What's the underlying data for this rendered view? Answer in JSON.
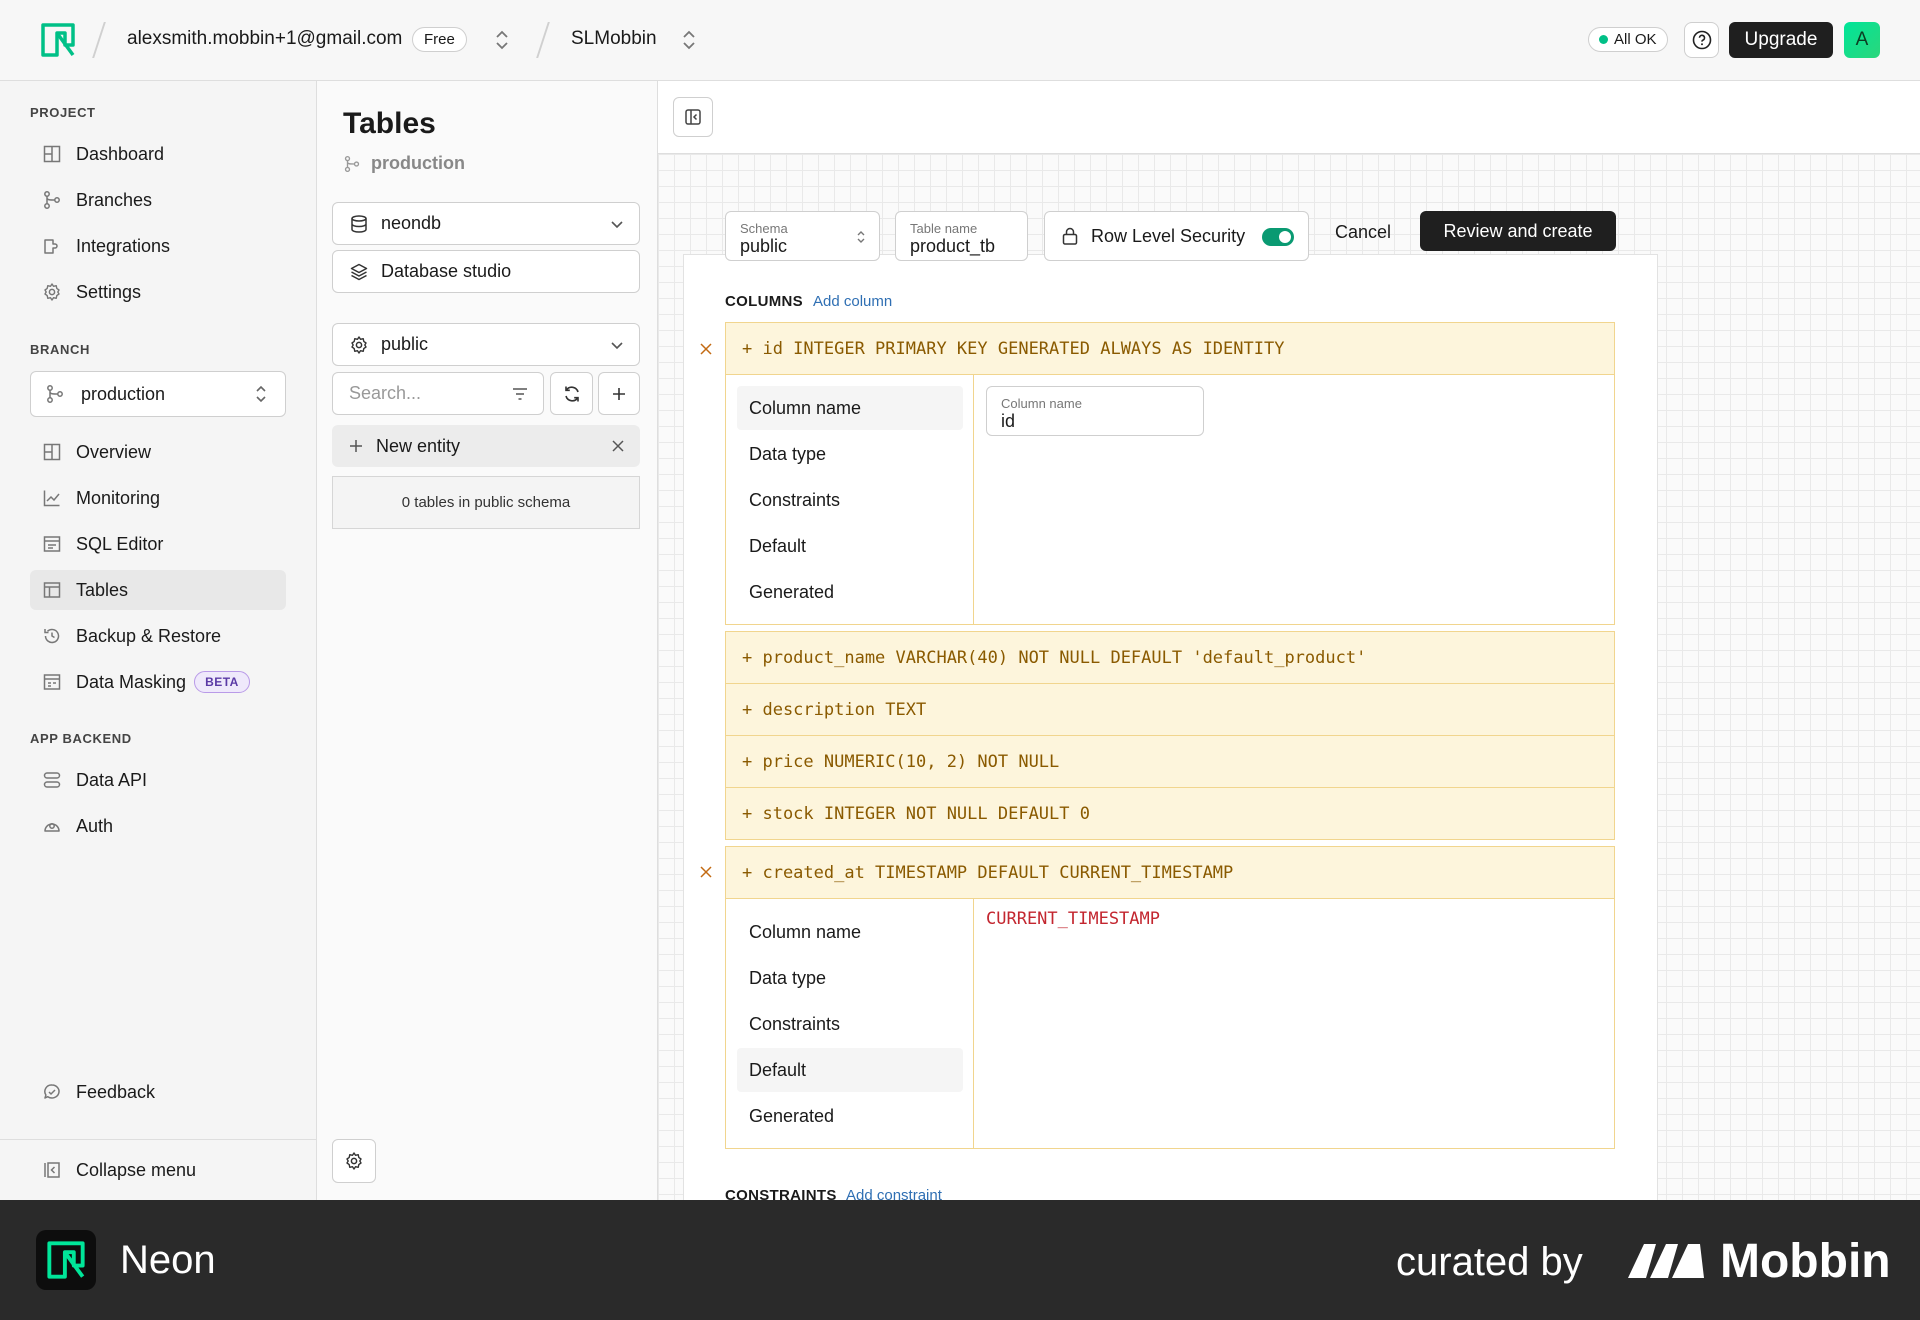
{
  "topbar": {
    "email": "alexsmith.mobbin+1@gmail.com",
    "plan_badge": "Free",
    "project_name": "SLMobbin",
    "status": "All OK",
    "upgrade_label": "Upgrade",
    "avatar_letter": "A"
  },
  "sidebar": {
    "project_label": "PROJECT",
    "project_items": [
      "Dashboard",
      "Branches",
      "Integrations",
      "Settings"
    ],
    "branch_label": "BRANCH",
    "branch_value": "production",
    "branch_items": [
      "Overview",
      "Monitoring",
      "SQL Editor",
      "Tables",
      "Backup & Restore",
      "Data Masking"
    ],
    "beta_badge": "BETA",
    "backend_label": "APP BACKEND",
    "backend_items": [
      "Data API",
      "Auth"
    ],
    "feedback_label": "Feedback",
    "collapse_label": "Collapse menu"
  },
  "tables_panel": {
    "title": "Tables",
    "branch": "production",
    "database": "neondb",
    "studio_label": "Database studio",
    "schema": "public",
    "search_placeholder": "Search...",
    "new_entity_label": "New entity",
    "empty_text": "0 tables in public schema"
  },
  "editor": {
    "schema_caption": "Schema",
    "schema_value": "public",
    "table_caption": "Table name",
    "table_value": "product_tb",
    "rls_label": "Row Level Security",
    "rls_enabled": true,
    "cancel_label": "Cancel",
    "review_label": "Review and create",
    "columns_label": "COLUMNS",
    "add_column_label": "Add column",
    "column_defs": [
      "+ id INTEGER PRIMARY KEY GENERATED ALWAYS AS IDENTITY",
      "+ product_name VARCHAR(40) NOT NULL DEFAULT 'default_product'",
      "+ description TEXT",
      "+ price NUMERIC(10, 2) NOT NULL",
      "+ stock INTEGER NOT NULL DEFAULT 0",
      "+ created_at TIMESTAMP DEFAULT CURRENT_TIMESTAMP"
    ],
    "menu_items": [
      "Column name",
      "Data type",
      "Constraints",
      "Default",
      "Generated"
    ],
    "column_name_caption": "Column name",
    "column_name_value": "id",
    "default_value": "CURRENT_TIMESTAMP",
    "constraints_label": "CONSTRAINTS",
    "add_constraint_label": "Add constraint"
  },
  "banner": {
    "app_name": "Neon",
    "curated_by": "curated by",
    "brand": "Mobbin"
  },
  "colors": {
    "neon_green": "#00e599",
    "sql_bg": "#fdf5dc",
    "sql_border": "#f1d58e",
    "sql_text": "#8a5a00",
    "accent_link": "#2f6fb3",
    "default_red": "#c3262f"
  }
}
